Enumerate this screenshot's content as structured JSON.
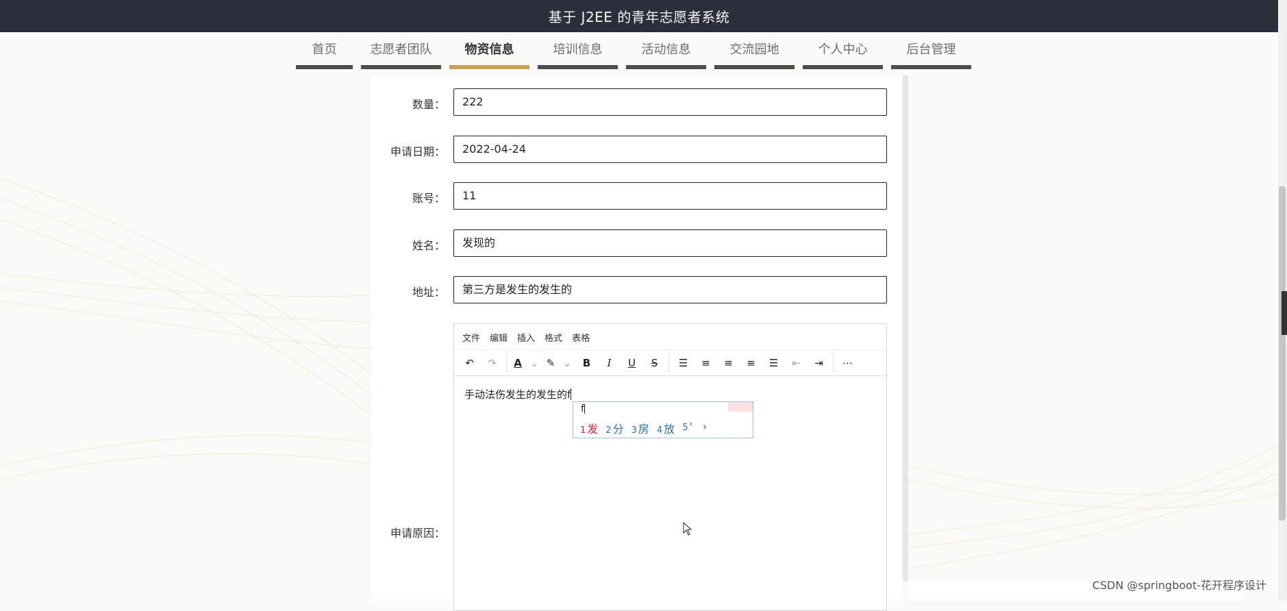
{
  "header": {
    "title": "基于 J2EE 的青年志愿者系统"
  },
  "nav": {
    "items": [
      {
        "label": "首页"
      },
      {
        "label": "志愿者团队"
      },
      {
        "label": "物资信息",
        "active": true
      },
      {
        "label": "培训信息"
      },
      {
        "label": "活动信息"
      },
      {
        "label": "交流园地"
      },
      {
        "label": "个人中心"
      },
      {
        "label": "后台管理"
      }
    ],
    "accent_color": "#c8a45a"
  },
  "form": {
    "quantity": {
      "label": "数量：",
      "value": "222"
    },
    "apply_date": {
      "label": "申请日期：",
      "value": "2022-04-24"
    },
    "account": {
      "label": "账号：",
      "value": "11"
    },
    "name": {
      "label": "姓名：",
      "value": "发现的"
    },
    "address": {
      "label": "地址：",
      "value": "第三方是发生的发生的"
    },
    "reason": {
      "label": "申请原因：",
      "menu": [
        "文件",
        "编辑",
        "插入",
        "格式",
        "表格"
      ],
      "content": "手动法伤发生的发生的f"
    }
  },
  "ime": {
    "pinyin": "f",
    "candidates": [
      {
        "num": "1",
        "text": "发"
      },
      {
        "num": "2",
        "text": "分"
      },
      {
        "num": "3",
        "text": "房"
      },
      {
        "num": "4",
        "text": "放"
      },
      {
        "num": "5",
        "text": "'"
      }
    ],
    "next": "›"
  },
  "watermark": "CSDN @springboot-花开程序设计"
}
